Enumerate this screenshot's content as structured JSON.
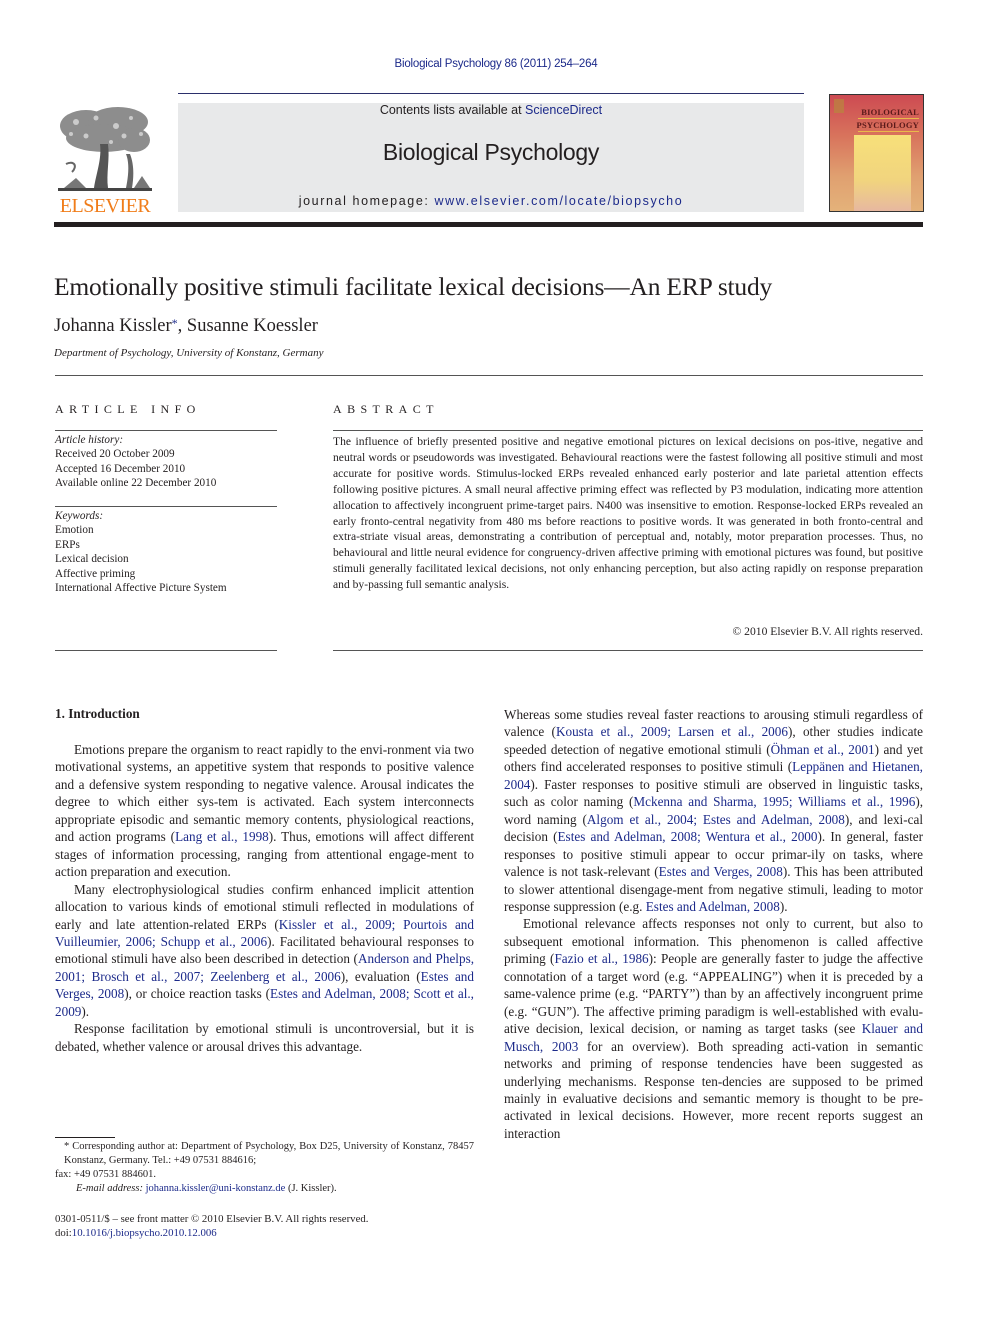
{
  "running_head": "Biological Psychology 86 (2011) 254–264",
  "header": {
    "publisher_logo_text": "ELSEVIER",
    "contents_prefix": "Contents lists available at ",
    "contents_link": "ScienceDirect",
    "journal_name": "Biological Psychology",
    "homepage_prefix": "journal homepage: ",
    "homepage_url": "www.elsevier.com/locate/biopsycho",
    "cover_title_line1": "BIOLOGICAL",
    "cover_title_line2": "PSYCHOLOGY",
    "colors": {
      "link": "#1c2a8a",
      "elsevier_orange": "#f07d1a",
      "banner_bg": "#e8e9ea"
    }
  },
  "article": {
    "title": "Emotionally positive stimuli facilitate lexical decisions—An ERP study",
    "authors": [
      {
        "name": "Johanna Kissler",
        "marker": "*"
      },
      {
        "name": "Susanne Koessler"
      }
    ],
    "author_separator": ", ",
    "affiliation": "Department of Psychology, University of Konstanz, Germany"
  },
  "article_info": {
    "heading": "ARTICLE INFO",
    "history_label": "Article history:",
    "history": [
      "Received 20 October 2009",
      "Accepted 16 December 2010",
      "Available online 22 December 2010"
    ],
    "keywords_label": "Keywords:",
    "keywords": [
      "Emotion",
      "ERPs",
      "Lexical decision",
      "Affective priming",
      "International Affective Picture System"
    ]
  },
  "abstract": {
    "heading": "ABSTRACT",
    "text": "The influence of briefly presented positive and negative emotional pictures on lexical decisions on pos-itive, negative and neutral words or pseudowords was investigated. Behavioural reactions were the fastest following all positive stimuli and most accurate for positive words. Stimulus-locked ERPs revealed enhanced early posterior and late parietal attention effects following positive pictures. A small neural affective priming effect was reflected by P3 modulation, indicating more attention allocation to affectively incongruent prime-target pairs. N400 was insensitive to emotion. Response-locked ERPs revealed an early fronto-central negativity from 480 ms before reactions to positive words. It was generated in both fronto-central and extra-striate visual areas, demonstrating a contribution of perceptual and, notably, motor preparation processes. Thus, no behavioural and little neural evidence for congruency-driven affective priming with emotional pictures was found, but positive stimuli generally facilitated lexical decisions, not only enhancing perception, but also acting rapidly on response preparation and by-passing full semantic analysis.",
    "copyright": "© 2010 Elsevier B.V. All rights reserved."
  },
  "body": {
    "section_heading": "1.  Introduction",
    "left_paragraphs": [
      [
        {
          "t": "Emotions prepare the organism to react rapidly to the envi-ronment via two motivational systems, an appetitive system that responds to positive valence and a defensive system responding to negative valence. Arousal indicates the degree to which either sys-tem is activated. Each system interconnects appropriate episodic and semantic memory contents, physiological reactions, and action programs ("
        },
        {
          "t": "Lang et al., 1998",
          "link": true
        },
        {
          "t": "). Thus, emotions will affect different stages of information processing, ranging from attentional engage-ment to action preparation and execution."
        }
      ],
      [
        {
          "t": "Many electrophysiological studies confirm enhanced implicit attention allocation to various kinds of emotional stimuli reflected in modulations of early and late attention-related ERPs ("
        },
        {
          "t": "Kissler et al., 2009; Pourtois and Vuilleumier, 2006; Schupp et al., 2006",
          "link": true
        },
        {
          "t": "). Facilitated behavioural responses to emotional stimuli have also been described in detection ("
        },
        {
          "t": "Anderson and Phelps, 2001; Brosch et al., 2007; Zeelenberg et al., 2006",
          "link": true
        },
        {
          "t": "), evaluation ("
        },
        {
          "t": "Estes and Verges, 2008",
          "link": true
        },
        {
          "t": "), or choice reaction tasks ("
        },
        {
          "t": "Estes and Adelman, 2008; Scott et al., 2009",
          "link": true
        },
        {
          "t": ")."
        }
      ],
      [
        {
          "t": "Response facilitation by emotional stimuli is uncontroversial, but it is debated, whether valence or arousal drives this advantage."
        }
      ]
    ],
    "right_paragraphs": [
      [
        {
          "t": "Whereas some studies reveal faster reactions to arousing stimuli regardless of valence ("
        },
        {
          "t": "Kousta et al., 2009; Larsen et al., 2006",
          "link": true
        },
        {
          "t": "), other studies indicate speeded detection of negative emotional stimuli ("
        },
        {
          "t": "Öhman et al., 2001",
          "link": true
        },
        {
          "t": ") and yet others find accelerated responses to positive stimuli ("
        },
        {
          "t": "Leppänen and Hietanen, 2004",
          "link": true
        },
        {
          "t": "). Faster responses to positive stimuli are observed in linguistic tasks, such as color naming ("
        },
        {
          "t": "Mckenna and Sharma, 1995; Williams et al., 1996",
          "link": true
        },
        {
          "t": "), word naming ("
        },
        {
          "t": "Algom et al., 2004; Estes and Adelman, 2008",
          "link": true
        },
        {
          "t": "), and lexi-cal decision ("
        },
        {
          "t": "Estes and Adelman, 2008; Wentura et al., 2000",
          "link": true
        },
        {
          "t": "). In general, faster responses to positive stimuli appear to occur primar-ily on tasks, where valence is not task-relevant ("
        },
        {
          "t": "Estes and Verges, 2008",
          "link": true
        },
        {
          "t": "). This has been attributed to slower attentional disengage-ment from negative stimuli, leading to motor response suppression (e.g. "
        },
        {
          "t": "Estes and Adelman, 2008",
          "link": true
        },
        {
          "t": ")."
        }
      ],
      [
        {
          "t": "Emotional relevance affects responses not only to current, but also to subsequent emotional information. This phenomenon is called affective priming ("
        },
        {
          "t": "Fazio et al., 1986",
          "link": true
        },
        {
          "t": "): People are generally faster to judge the affective connotation of a target word (e.g. “APPEALING”) when it is preceded by a same-valence prime (e.g. “PARTY”) than by an affectively incongruent prime (e.g. “GUN”). The affective priming paradigm is well-established with evalu-ative decision, lexical decision, or naming as target tasks (see "
        },
        {
          "t": "Klauer and Musch, 2003",
          "link": true
        },
        {
          "t": " for an overview). Both spreading acti-vation in semantic networks and priming of response tendencies have been suggested as underlying mechanisms. Response ten-dencies are supposed to be primed mainly in evaluative decisions and semantic memory is thought to be pre-activated in lexical decisions. However, more recent reports suggest an interaction"
        }
      ]
    ]
  },
  "footnote": {
    "marker": "*",
    "corresponding_label": " Corresponding author at: Department of Psychology, Box D25, University of Konstanz, 78457 Konstanz, Germany. Tel.: +49 07531 884616;",
    "fax": "fax: +49 07531 884601.",
    "email_label": "E-mail address: ",
    "email": "johanna.kissler@uni-konstanz.de",
    "email_suffix": " (J. Kissler)."
  },
  "front_matter": {
    "issn_line": "0301-0511/$ – see front matter © 2010 Elsevier B.V. All rights reserved.",
    "doi_prefix": "doi:",
    "doi": "10.1016/j.biopsycho.2010.12.006"
  }
}
